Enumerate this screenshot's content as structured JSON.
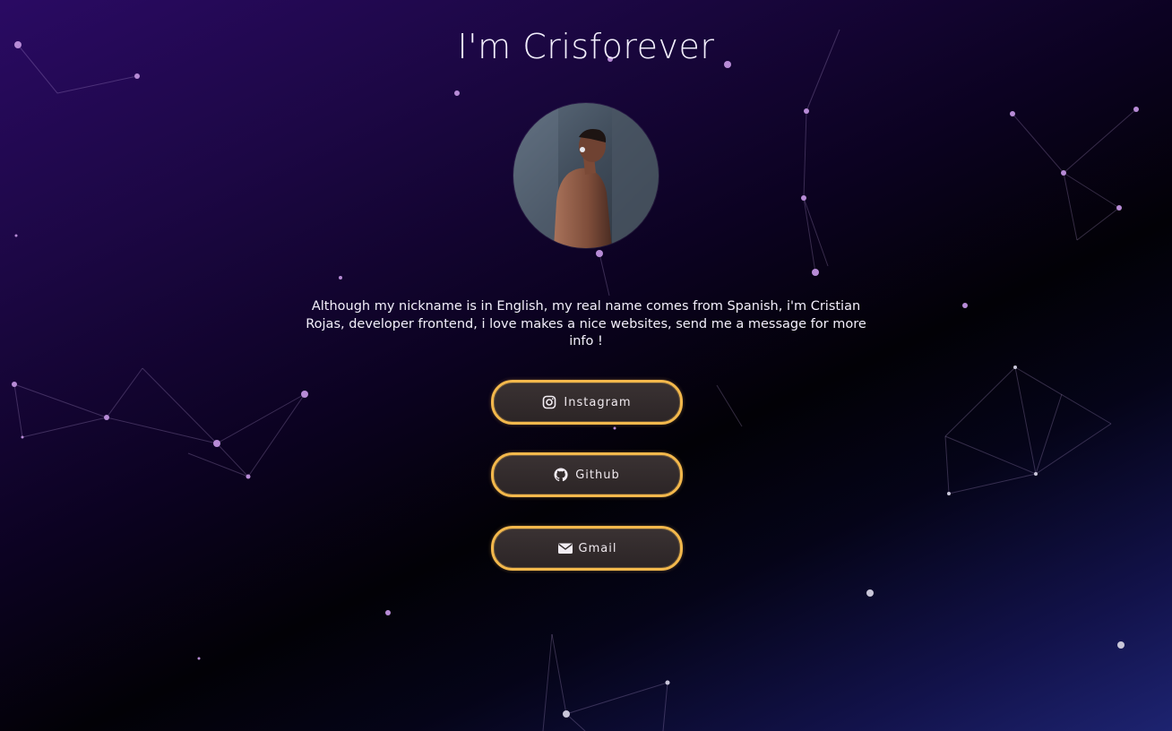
{
  "header": {
    "title": "I'm Crisforever"
  },
  "profile": {
    "avatar_alt": "profile photo",
    "bio": "Although my nickname is in English, my real name comes from Spanish, i'm Cristian Rojas, developer frontend, i love makes a nice websites, send me a message for more info !"
  },
  "links": [
    {
      "label": "Instagram",
      "icon": "instagram-icon"
    },
    {
      "label": "Github",
      "icon": "github-icon"
    },
    {
      "label": "Gmail",
      "icon": "mail-icon"
    }
  ],
  "colors": {
    "accent_border": "#f3b84c",
    "button_fill": "#332b2c",
    "text": "#ffffff",
    "background_top": "#2a0a63",
    "background_mid": "#020106",
    "background_bottom": "#1d2370",
    "particle": "#b78bd6"
  }
}
